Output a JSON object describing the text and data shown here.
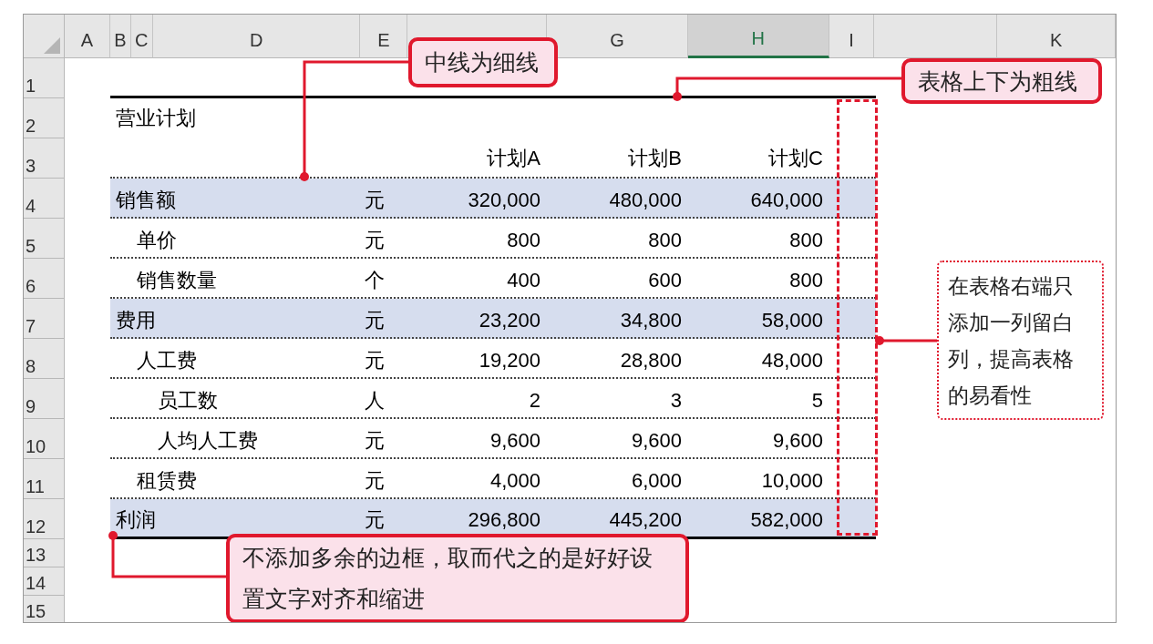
{
  "column_headers": [
    {
      "label": "A",
      "selected": false
    },
    {
      "label": "B",
      "selected": false
    },
    {
      "label": "C",
      "selected": false
    },
    {
      "label": "D",
      "selected": false
    },
    {
      "label": "E",
      "selected": false
    },
    {
      "selected": false
    },
    {
      "label": "G",
      "selected": false
    },
    {
      "label": "H",
      "selected": true
    },
    {
      "label": "I",
      "selected": false
    },
    {
      "selected": false
    },
    {
      "label": "K",
      "selected": false
    }
  ],
  "row_headers": [
    "1",
    "2",
    "3",
    "4",
    "5",
    "6",
    "7",
    "8",
    "9",
    "10",
    "11",
    "12",
    "13",
    "14",
    "15"
  ],
  "table": {
    "title": "营业计划",
    "columns": [
      "计划A",
      "计划B",
      "计划C"
    ],
    "rows": [
      {
        "label": "销售额",
        "unit": "元",
        "values": [
          "320,000",
          "480,000",
          "640,000"
        ],
        "highlighted": true,
        "children": [
          {
            "label": "单价",
            "unit": "元",
            "values": [
              "800",
              "800",
              "800"
            ],
            "highlighted": false
          },
          {
            "label": "销售数量",
            "unit": "个",
            "values": [
              "400",
              "600",
              "800"
            ],
            "highlighted": false
          }
        ]
      },
      {
        "label": "费用",
        "unit": "元",
        "values": [
          "23,200",
          "34,800",
          "58,000"
        ],
        "highlighted": true,
        "children": [
          {
            "label": "人工费",
            "unit": "元",
            "values": [
              "19,200",
              "28,800",
              "48,000"
            ],
            "highlighted": false,
            "children": [
              {
                "label": "员工数",
                "unit": "人",
                "values": [
                  "2",
                  "3",
                  "5"
                ],
                "highlighted": false
              },
              {
                "label": "人均人工费",
                "unit": "元",
                "values": [
                  "9,600",
                  "9,600",
                  "9,600"
                ],
                "highlighted": false
              }
            ]
          },
          {
            "label": "租赁费",
            "unit": "元",
            "values": [
              "4,000",
              "6,000",
              "10,000"
            ],
            "highlighted": false
          }
        ]
      },
      {
        "label": "利润",
        "unit": "元",
        "values": [
          "296,800",
          "445,200",
          "582,000"
        ],
        "highlighted": true
      }
    ]
  },
  "callouts": [
    {
      "kind": "solid",
      "text": "中线为细线"
    },
    {
      "kind": "solid",
      "text": "表格上下为粗线"
    },
    {
      "kind": "dotted",
      "text": "在表格右端只添加一列留白列，提高表格的易看性"
    },
    {
      "kind": "solid",
      "text": "不添加多余的边框，取而代之的是好好设置文字对齐和缩进"
    }
  ]
}
